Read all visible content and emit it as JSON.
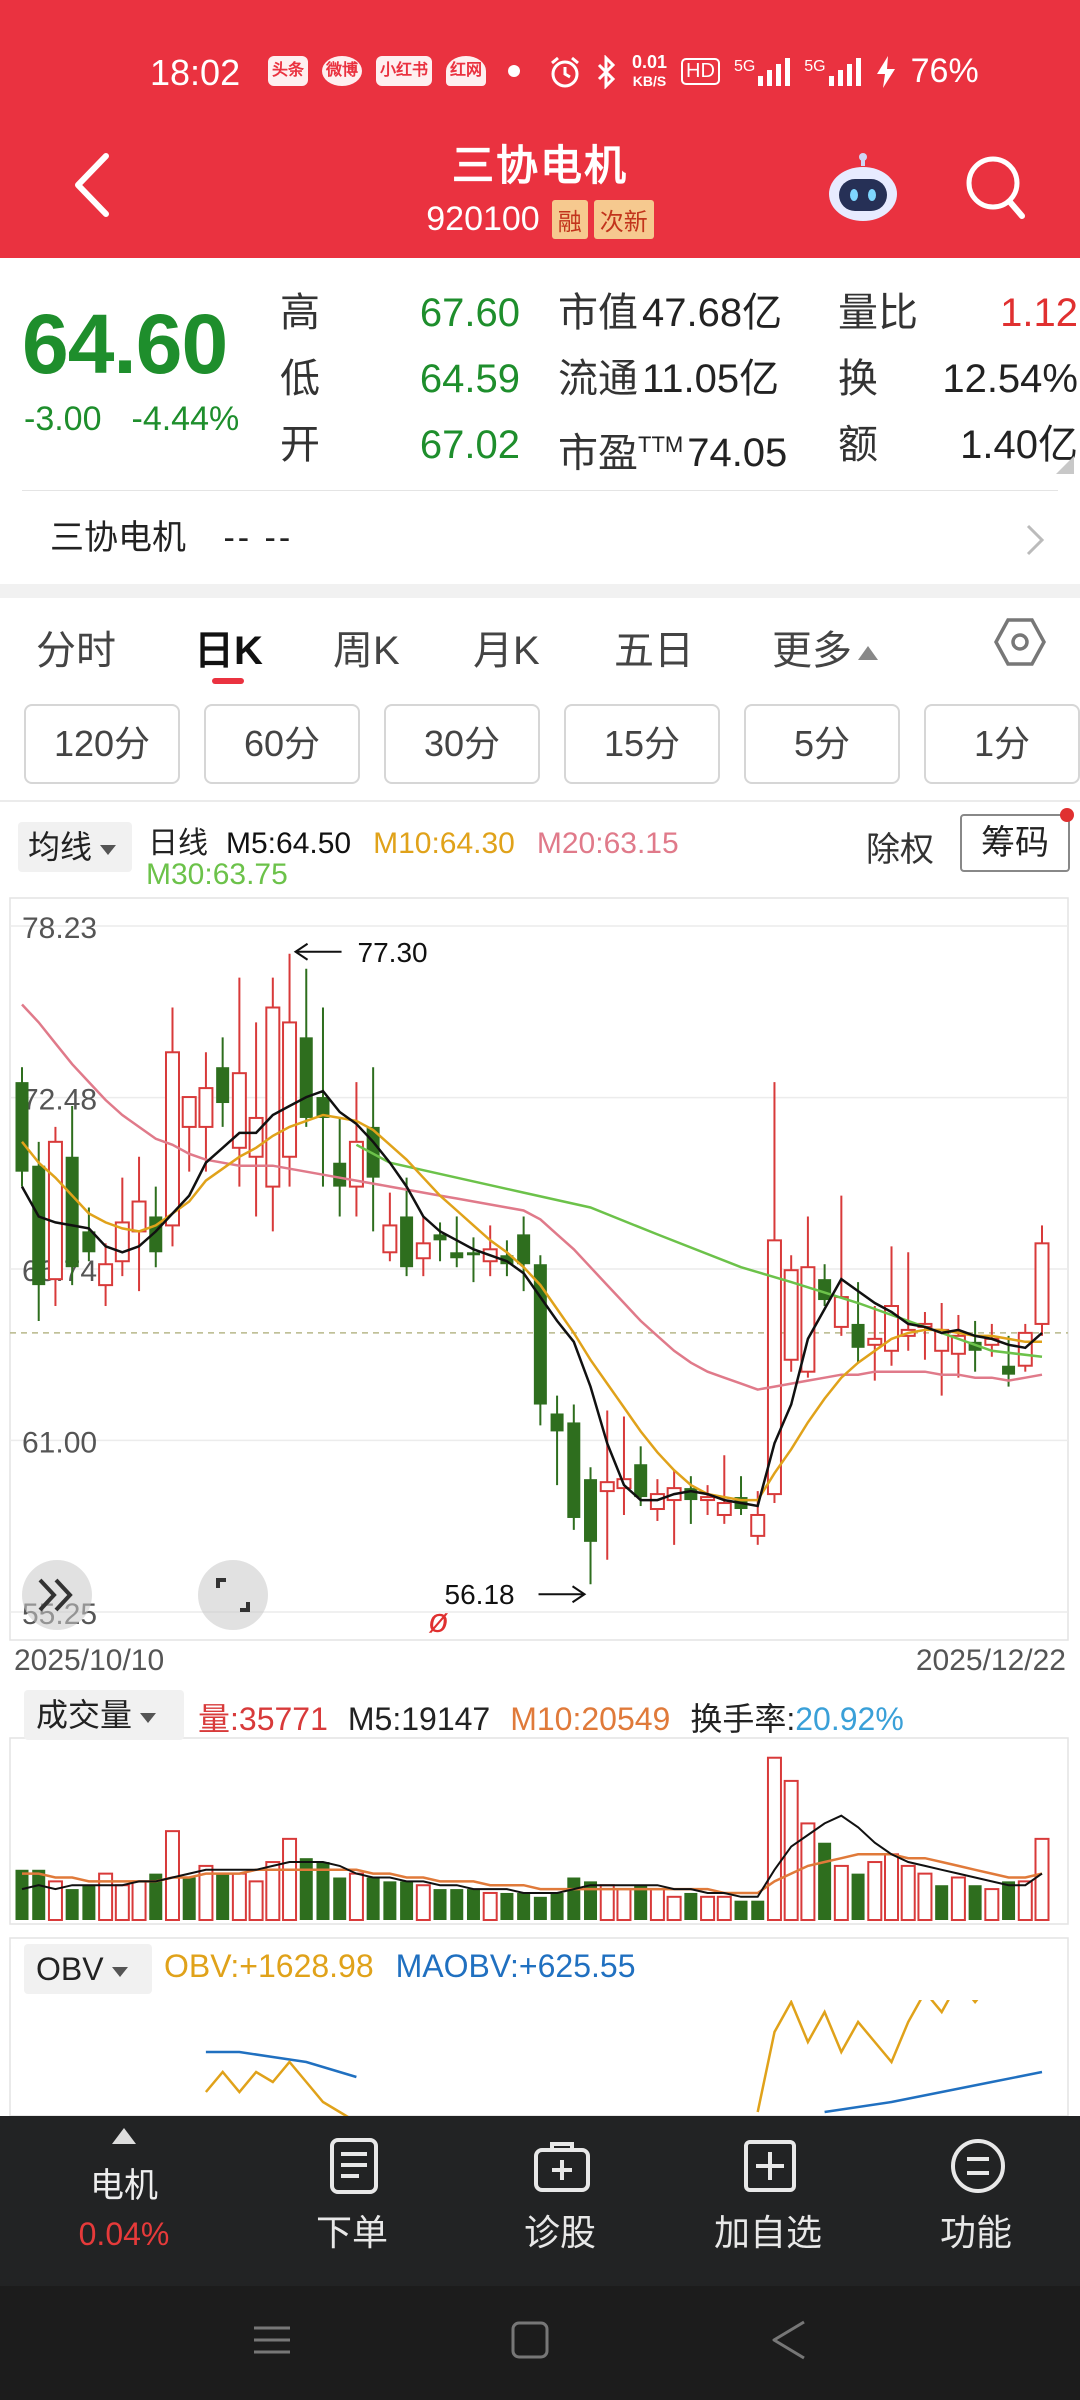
{
  "status_bar": {
    "time": "18:02",
    "left_icons": [
      "头条",
      "微博",
      "小红书",
      "红网"
    ],
    "net_speed_value": "0.01",
    "net_speed_unit": "KB/S",
    "hd_label": "HD",
    "sim1": "5G",
    "sim2": "5G",
    "battery": "76%"
  },
  "header": {
    "title": "三协电机",
    "code": "920100",
    "tags": [
      "融",
      "次新"
    ]
  },
  "quote": {
    "price": "64.60",
    "change": "-3.00",
    "change_pct": "-4.44%",
    "high_label": "高",
    "high": "67.60",
    "low_label": "低",
    "low": "64.59",
    "open_label": "开",
    "open": "67.02",
    "mktcap_label": "市值",
    "mktcap": "47.68亿",
    "float_label": "流通",
    "float": "11.05亿",
    "pe_label": "市盈",
    "pe_sup": "TTM",
    "pe": "74.05",
    "volratio_label": "量比",
    "volratio": "1.12",
    "turnover_label": "换",
    "turnover": "12.54%",
    "amount_label": "额",
    "amount": "1.40亿"
  },
  "sector": {
    "name": "三协电机",
    "value": "-- --"
  },
  "tabs": [
    "分时",
    "日K",
    "周K",
    "月K",
    "五日",
    "更多"
  ],
  "active_tab": "日K",
  "periods": [
    "120分",
    "60分",
    "30分",
    "15分",
    "5分",
    "1分"
  ],
  "chart_legend": {
    "ma_button": "均线",
    "period": "日线",
    "m5": "M5:64.50",
    "m10": "M10:64.30",
    "m20": "M20:63.15",
    "m30": "M30:63.75",
    "exright": "除权",
    "chips": "筹码"
  },
  "volume_legend": {
    "button": "成交量",
    "vol": "量:35771",
    "m5": "M5:19147",
    "m10": "M10:20549",
    "turnover_label": "换手率:",
    "turnover": "20.92%"
  },
  "obv_legend": {
    "button": "OBV",
    "obv": "OBV:+1628.98",
    "maobv": "MAOBV:+625.55"
  },
  "colors": {
    "up": "#d83a3a",
    "down": "#2e6e1e",
    "m5": "#111111",
    "m10": "#e0a21a",
    "m20": "#e07a8a",
    "m30": "#6cc24a",
    "obv": "#e0a21a",
    "maobv": "#2070c0",
    "header": "#ea3240"
  },
  "chart_data": {
    "type": "candlestick",
    "y_ticks": [
      "78.23",
      "72.48",
      "66.74",
      "61.00",
      "55.25"
    ],
    "ylim": [
      55.25,
      78.23
    ],
    "date_start": "2025/10/10",
    "date_end": "2025/12/22",
    "max_label": "77.30",
    "min_label": "56.18",
    "reference_price": 64.6,
    "candles": [
      [
        73,
        73.5,
        69.5,
        70
      ],
      [
        70.2,
        71,
        65,
        66.2
      ],
      [
        66.4,
        71.5,
        65.5,
        71
      ],
      [
        70.5,
        72.2,
        66.2,
        66.8
      ],
      [
        68,
        68.8,
        67,
        67.3
      ],
      [
        66.2,
        67.6,
        65.5,
        66.9
      ],
      [
        67,
        69.8,
        66.5,
        68.3
      ],
      [
        68,
        70.5,
        66,
        69
      ],
      [
        68.5,
        69.5,
        66.8,
        67.3
      ],
      [
        68.2,
        75.5,
        67.5,
        74
      ],
      [
        71.5,
        72.5,
        70,
        72.5
      ],
      [
        71.5,
        74,
        70,
        72.8
      ],
      [
        73.5,
        74.5,
        71.5,
        72.3
      ],
      [
        70.8,
        76.5,
        69.5,
        73.3
      ],
      [
        70.5,
        75,
        68.5,
        71.8
      ],
      [
        69.5,
        76.5,
        68,
        75.5
      ],
      [
        70.5,
        77.3,
        69.5,
        75
      ],
      [
        74.5,
        76.8,
        71.5,
        71.8
      ],
      [
        72.5,
        75.5,
        69.5,
        71.8
      ],
      [
        70.3,
        71.8,
        68.5,
        69.5
      ],
      [
        69.5,
        73,
        68.5,
        71
      ],
      [
        71.5,
        73.5,
        68,
        69.8
      ],
      [
        67.3,
        69.3,
        67,
        68.2
      ],
      [
        68.5,
        69.8,
        66.5,
        66.8
      ],
      [
        67.1,
        68.5,
        66.5,
        67.6
      ],
      [
        67.9,
        68.3,
        67,
        67.7
      ],
      [
        67.3,
        68.5,
        66.8,
        67.1
      ],
      [
        67.3,
        67.8,
        66.3,
        67.2
      ],
      [
        67,
        68.2,
        66.5,
        67.4
      ],
      [
        67.2,
        67.7,
        66.5,
        66.9
      ],
      [
        67.9,
        68.5,
        66,
        66.9
      ],
      [
        66.9,
        67.2,
        61.5,
        62.2
      ],
      [
        61.9,
        62.5,
        59.5,
        61.3
      ],
      [
        61.6,
        62.2,
        58,
        58.4
      ],
      [
        59.7,
        60.1,
        56.18,
        57.6
      ],
      [
        59.3,
        62,
        57,
        59.6
      ],
      [
        59.4,
        61.8,
        58.5,
        59.7
      ],
      [
        60.2,
        60.8,
        58.8,
        59.1
      ],
      [
        58.7,
        59.7,
        58.3,
        59.2
      ],
      [
        59,
        60,
        57.5,
        59.4
      ],
      [
        59.4,
        59.8,
        58.2,
        59
      ],
      [
        59,
        59.5,
        58.5,
        59.1
      ],
      [
        58.5,
        60.5,
        58.2,
        58.9
      ],
      [
        59.1,
        59.8,
        58.5,
        58.7
      ],
      [
        57.8,
        59.3,
        57.5,
        58.5
      ],
      [
        59.2,
        73,
        58.9,
        67.7
      ],
      [
        63.7,
        67.2,
        63.3,
        66.7
      ],
      [
        63.3,
        68.5,
        63.1,
        66.8
      ],
      [
        66.4,
        66.9,
        65.5,
        65.7
      ],
      [
        64.8,
        69.2,
        64.5,
        65.8
      ],
      [
        64.9,
        66.3,
        63.6,
        64.1
      ],
      [
        64.2,
        65.5,
        63,
        64.4
      ],
      [
        64,
        67.5,
        63.5,
        65.5
      ],
      [
        64.5,
        67.3,
        64,
        64.7
      ],
      [
        64.8,
        65.3,
        63.7,
        64.9
      ],
      [
        64,
        65.6,
        62.5,
        64.7
      ],
      [
        63.9,
        65.2,
        63.1,
        64.5
      ],
      [
        64.3,
        65,
        63.3,
        64
      ],
      [
        64.2,
        64.9,
        63.8,
        64.4
      ],
      [
        63.5,
        64.5,
        62.8,
        63.2
      ],
      [
        63.5,
        64.9,
        63.3,
        64.6
      ],
      [
        64.9,
        68.2,
        64.5,
        67.6
      ]
    ],
    "ma5": [
      69.5,
      68.5,
      68.3,
      68.2,
      68.1,
      67.5,
      67.3,
      67.5,
      68.0,
      68.6,
      69.2,
      70.3,
      70.8,
      71.3,
      71.3,
      71.9,
      72.2,
      72.5,
      72.7,
      72.0,
      71.6,
      71.0,
      70.3,
      69.5,
      68.5,
      68.0,
      67.7,
      67.4,
      67.2,
      67.0,
      66.6,
      65.8,
      65.0,
      64.3,
      62.8,
      60.9,
      59.5,
      59.0,
      59.0,
      59.2,
      59.3,
      59.2,
      59.0,
      58.9,
      58.8,
      60.9,
      62.2,
      64.4,
      65.4,
      66.4,
      66.0,
      65.6,
      65.3,
      64.9,
      64.8,
      64.6,
      64.7,
      64.5,
      64.4,
      64.2,
      64.1,
      64.6
    ],
    "ma10": [
      71.0,
      70.3,
      69.8,
      69.2,
      68.6,
      68.3,
      68.1,
      68.0,
      68.2,
      68.6,
      69.0,
      69.7,
      70.1,
      70.5,
      70.8,
      71.2,
      71.5,
      71.7,
      71.9,
      71.8,
      71.7,
      71.4,
      70.9,
      70.4,
      69.8,
      69.2,
      68.7,
      68.2,
      67.7,
      67.3,
      66.8,
      66.2,
      65.4,
      64.6,
      63.7,
      62.9,
      62.1,
      61.3,
      60.6,
      60.0,
      59.5,
      59.2,
      59.1,
      59.0,
      59.0,
      59.9,
      60.7,
      61.6,
      62.4,
      63.1,
      63.6,
      64.0,
      64.4,
      64.6,
      64.7,
      64.7,
      64.6,
      64.5,
      64.5,
      64.4,
      64.3,
      64.3
    ],
    "ma20": [
      75.6,
      75.0,
      74.3,
      73.6,
      73.0,
      72.4,
      71.9,
      71.5,
      71.1,
      70.9,
      70.6,
      70.4,
      70.3,
      70.2,
      70.2,
      70.2,
      70.1,
      70.0,
      69.9,
      69.8,
      69.7,
      69.6,
      69.5,
      69.4,
      69.3,
      69.2,
      69.1,
      69.0,
      68.9,
      68.8,
      68.7,
      68.4,
      67.9,
      67.4,
      66.8,
      66.2,
      65.6,
      65.0,
      64.5,
      64.0,
      63.6,
      63.3,
      63.1,
      62.9,
      62.7,
      62.8,
      62.9,
      63.0,
      63.1,
      63.2,
      63.2,
      63.3,
      63.3,
      63.3,
      63.3,
      63.2,
      63.2,
      63.1,
      63.1,
      63.0,
      63.1,
      63.2
    ],
    "ma30_x": [
      20,
      22,
      26,
      30,
      34,
      38,
      43,
      46,
      50,
      55,
      58,
      61
    ],
    "ma30": [
      70.9,
      70.3,
      69.8,
      69.3,
      68.8,
      67.9,
      66.8,
      66.3,
      65.6,
      64.6,
      64.0,
      63.8
    ],
    "volumes": [
      13,
      13,
      10,
      8,
      9,
      12,
      9,
      10,
      12,
      23,
      11,
      14,
      12,
      12,
      10,
      15,
      21,
      16,
      15,
      11,
      12,
      11,
      10,
      10,
      9,
      8,
      8,
      8,
      7,
      7,
      7,
      6,
      7,
      11,
      10,
      9,
      8,
      9,
      8,
      6,
      7,
      6,
      6,
      5,
      5,
      42,
      36,
      25,
      20,
      14,
      12,
      15,
      17,
      14,
      12,
      9,
      11,
      9,
      8,
      10,
      10,
      21
    ],
    "vol_up": [
      false,
      false,
      true,
      false,
      false,
      true,
      true,
      true,
      false,
      true,
      false,
      true,
      false,
      true,
      true,
      true,
      true,
      false,
      false,
      false,
      true,
      false,
      false,
      false,
      true,
      false,
      false,
      false,
      true,
      false,
      false,
      false,
      false,
      false,
      false,
      true,
      true,
      false,
      true,
      true,
      false,
      true,
      true,
      false,
      false,
      true,
      true,
      true,
      false,
      true,
      false,
      true,
      true,
      true,
      true,
      false,
      true,
      false,
      true,
      false,
      true,
      true
    ],
    "vol_m5": [
      8,
      9,
      8,
      9,
      9,
      9,
      9,
      10,
      10,
      11,
      12,
      13,
      13,
      13,
      13,
      14,
      15,
      15,
      15,
      14,
      12,
      11,
      11,
      10,
      10,
      9,
      9,
      8,
      8,
      8,
      7,
      7,
      7,
      8,
      9,
      9,
      9,
      9,
      9,
      8,
      8,
      7,
      7,
      6,
      6,
      13,
      19,
      22,
      25,
      27,
      24,
      20,
      17,
      15,
      14,
      13,
      12,
      11,
      10,
      9,
      9,
      12
    ],
    "vol_m10": [
      12,
      12,
      11,
      11,
      10,
      10,
      10,
      10,
      10,
      11,
      11,
      12,
      12,
      12,
      13,
      13,
      13,
      13,
      13,
      13,
      13,
      12,
      12,
      11,
      11,
      10,
      10,
      10,
      9,
      9,
      9,
      8,
      8,
      8,
      8,
      8,
      8,
      8,
      8,
      8,
      8,
      8,
      7,
      7,
      7,
      10,
      12,
      14,
      15,
      16,
      17,
      17,
      17,
      16,
      16,
      15,
      14,
      13,
      12,
      11,
      11,
      12
    ],
    "obv_visible": [
      [
        11,
        2
      ],
      [
        12,
        4
      ],
      [
        13,
        2
      ],
      [
        14,
        4
      ],
      [
        15,
        3
      ],
      [
        16,
        5
      ],
      [
        17,
        3
      ],
      [
        18,
        1
      ],
      [
        19,
        0
      ],
      [
        20,
        -1
      ],
      [
        44,
        0
      ],
      [
        45,
        8
      ],
      [
        46,
        11
      ],
      [
        47,
        7
      ],
      [
        48,
        10
      ],
      [
        49,
        6
      ],
      [
        50,
        9
      ],
      [
        51,
        7
      ],
      [
        52,
        5
      ],
      [
        53,
        9
      ],
      [
        54,
        12
      ],
      [
        55,
        10
      ],
      [
        56,
        13
      ],
      [
        57,
        11
      ],
      [
        58,
        13
      ],
      [
        59,
        15
      ],
      [
        60,
        14
      ],
      [
        61,
        18
      ]
    ],
    "maobv_visible": [
      [
        11,
        6
      ],
      [
        13,
        6
      ],
      [
        15,
        5.5
      ],
      [
        17,
        5
      ],
      [
        19,
        4
      ],
      [
        20,
        3.5
      ],
      [
        48,
        0
      ],
      [
        52,
        1
      ],
      [
        55,
        2
      ],
      [
        58,
        3
      ],
      [
        61,
        4
      ]
    ]
  },
  "bottom_nav": {
    "sector_name": "电机",
    "sector_change": "0.04%",
    "items": [
      "下单",
      "诊股",
      "加自选",
      "功能"
    ]
  }
}
